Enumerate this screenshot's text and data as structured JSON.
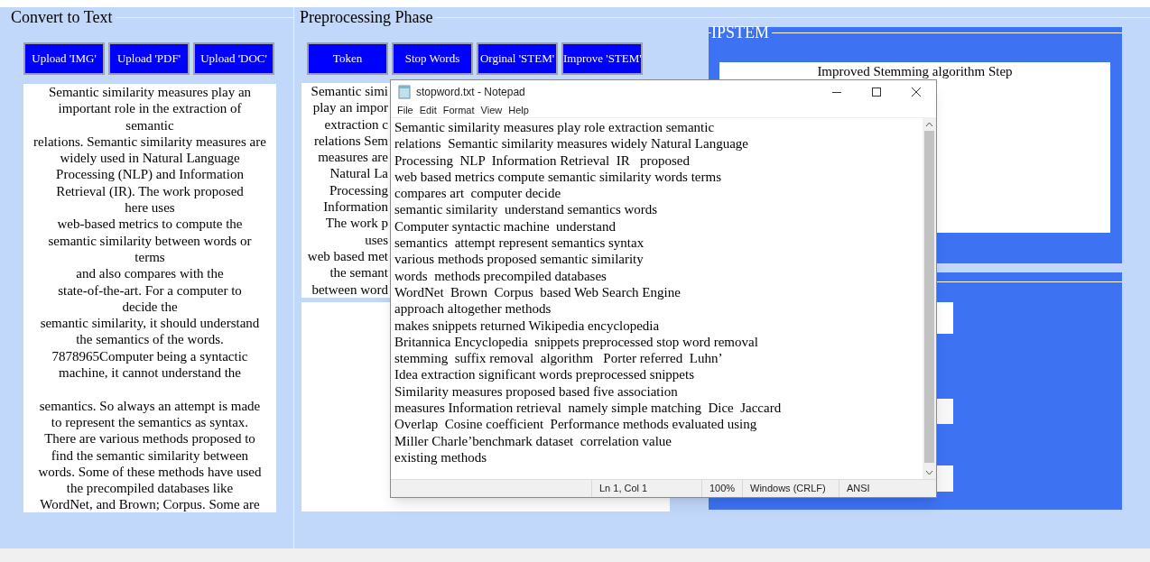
{
  "left_panel": {
    "title": "Convert to Text",
    "buttons": [
      "Upload 'IMG'",
      "Upload 'PDF'",
      "Upload 'DOC'"
    ],
    "paragraphs": [
      [
        "Semantic similarity measures play an",
        "important role in the extraction of",
        "semantic",
        "relations. Semantic similarity measures are",
        "widely used in Natural Language",
        "Processing (NLP) and Information",
        "Retrieval (IR). The work proposed",
        "here uses",
        "web-based metrics to compute the",
        "semantic similarity between words or",
        "terms",
        "and also compares with the",
        "state-of-the-art. For a computer to",
        "decide the",
        "semantic similarity, it should understand",
        "the semantics of the words.",
        "7878965Computer being a syntactic",
        "machine, it cannot understand the"
      ],
      [
        "semantics. So always an attempt is made",
        "to represent the semantics as syntax.",
        "There are various methods proposed to",
        "find the semantic similarity between",
        "words. Some of these methods have used",
        "the precompiled databases like",
        "WordNet, and Brown; Corpus. Some are"
      ]
    ]
  },
  "preprocessing_panel": {
    "title": "Preprocessing Phase",
    "buttons": [
      "Token",
      "Stop Words",
      "Orginal 'STEM'",
      "Improve 'STEM'"
    ],
    "text_fragments": [
      "Semantic simi",
      "play an impor",
      "extraction c",
      "relations  Sem",
      "measures are",
      "Natural La",
      "Processing",
      "Information",
      "The work p",
      "uses",
      "web based met",
      "the semant",
      "between word"
    ]
  },
  "ipstem_panel": {
    "title": "IPSTEM",
    "output_title": "Improved Stemming algorithm Step"
  },
  "notepad": {
    "title": "stopword.txt - Notepad",
    "menu": [
      "File",
      "Edit",
      "Format",
      "View",
      "Help"
    ],
    "lines": [
      "Semantic similarity measures play role extraction semantic",
      "relations  Semantic similarity measures widely Natural Language",
      "Processing  NLP  Information Retrieval  IR   proposed",
      "web based metrics compute semantic similarity words terms",
      "compares art  computer decide",
      "semantic similarity  understand semantics words",
      "Computer syntactic machine  understand",
      "semantics  attempt represent semantics syntax",
      "various methods proposed semantic similarity",
      "words  methods precompiled databases",
      "WordNet  Brown  Corpus  based Web Search Engine",
      "approach altogether methods",
      "makes snippets returned Wikipedia encyclopedia",
      "Britannica Encyclopedia  snippets preprocessed stop word removal",
      "stemming  suffix removal  algorithm   Porter referred  Luhn’",
      "Idea extraction significant words preprocessed snippets",
      "Similarity measures proposed based five association",
      "measures Information retrieval  namely simple matching  Dice  Jaccard",
      "Overlap  Cosine coefficient  Performance methods evaluated using",
      "Miller Charle’benchmark dataset  correlation value",
      "existing methods"
    ],
    "status_bar": [
      "Ln 1, Col 1",
      "100%",
      "Windows (CRLF)",
      "ANSI"
    ]
  }
}
